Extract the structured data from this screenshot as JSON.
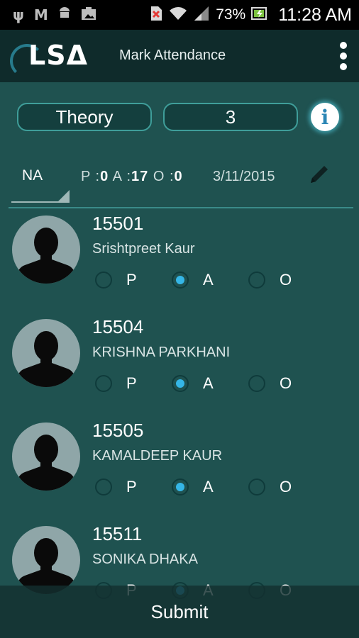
{
  "status_bar": {
    "left_icons": [
      "usb-icon",
      "m-app-icon",
      "android-icon",
      "photo-icon"
    ],
    "battery_percent": "73%",
    "time": "11:28 AM"
  },
  "app_bar": {
    "logo_text": "LSΔ",
    "title": "Mark Attendance",
    "menu_icon": "overflow-menu-icon"
  },
  "selectors": {
    "type": "Theory",
    "number": "3",
    "info_glyph": "i"
  },
  "summary": {
    "filter": "NA",
    "p_label": "P :",
    "p_value": "0",
    "a_label": "A :",
    "a_value": "17",
    "o_label": "O :",
    "o_value": "0",
    "date": "3/11/2015"
  },
  "option_labels": {
    "p": "P",
    "a": "A",
    "o": "O"
  },
  "students": [
    {
      "roll": "15501",
      "name": "Srishtpreet Kaur",
      "selected": "A"
    },
    {
      "roll": "15504",
      "name": "KRISHNA PARKHANI",
      "selected": "A"
    },
    {
      "roll": "15505",
      "name": "KAMALDEEP KAUR",
      "selected": "A"
    },
    {
      "roll": "15511",
      "name": "SONIKA DHAKA",
      "selected": "A"
    }
  ],
  "submit_label": "Submit",
  "colors": {
    "background": "#1f5250",
    "app_bar": "#0f2b2b",
    "accent": "#35b6e6"
  }
}
